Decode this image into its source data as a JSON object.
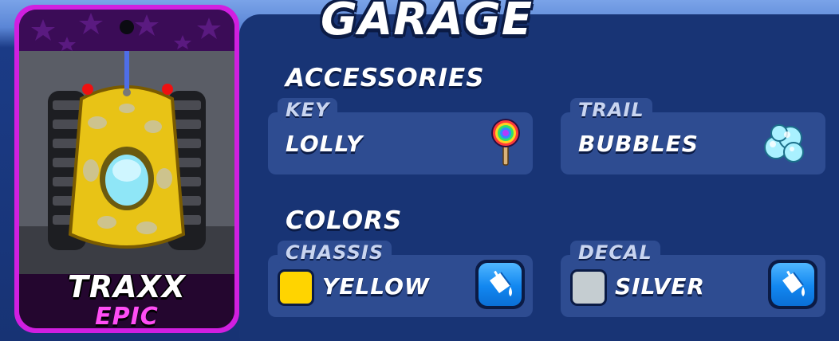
{
  "title": "GARAGE",
  "card": {
    "name": "TRAXX",
    "rarity": "EPIC",
    "rarity_color": "#ff4df5",
    "frame_color": "#d11fe0"
  },
  "accessories": {
    "heading": "ACCESSORIES",
    "key": {
      "label": "KEY",
      "value": "LOLLY",
      "icon": "lollipop-icon"
    },
    "trail": {
      "label": "TRAIL",
      "value": "BUBBLES",
      "icon": "bubbles-icon"
    }
  },
  "colors": {
    "heading": "COLORS",
    "chassis": {
      "label": "CHASSIS",
      "value": "YELLOW",
      "swatch": "#ffd400",
      "button_icon": "paint-bucket-icon"
    },
    "decal": {
      "label": "DECAL",
      "value": "SILVER",
      "swatch": "#c5cdd1",
      "button_icon": "paint-bucket-icon"
    }
  }
}
